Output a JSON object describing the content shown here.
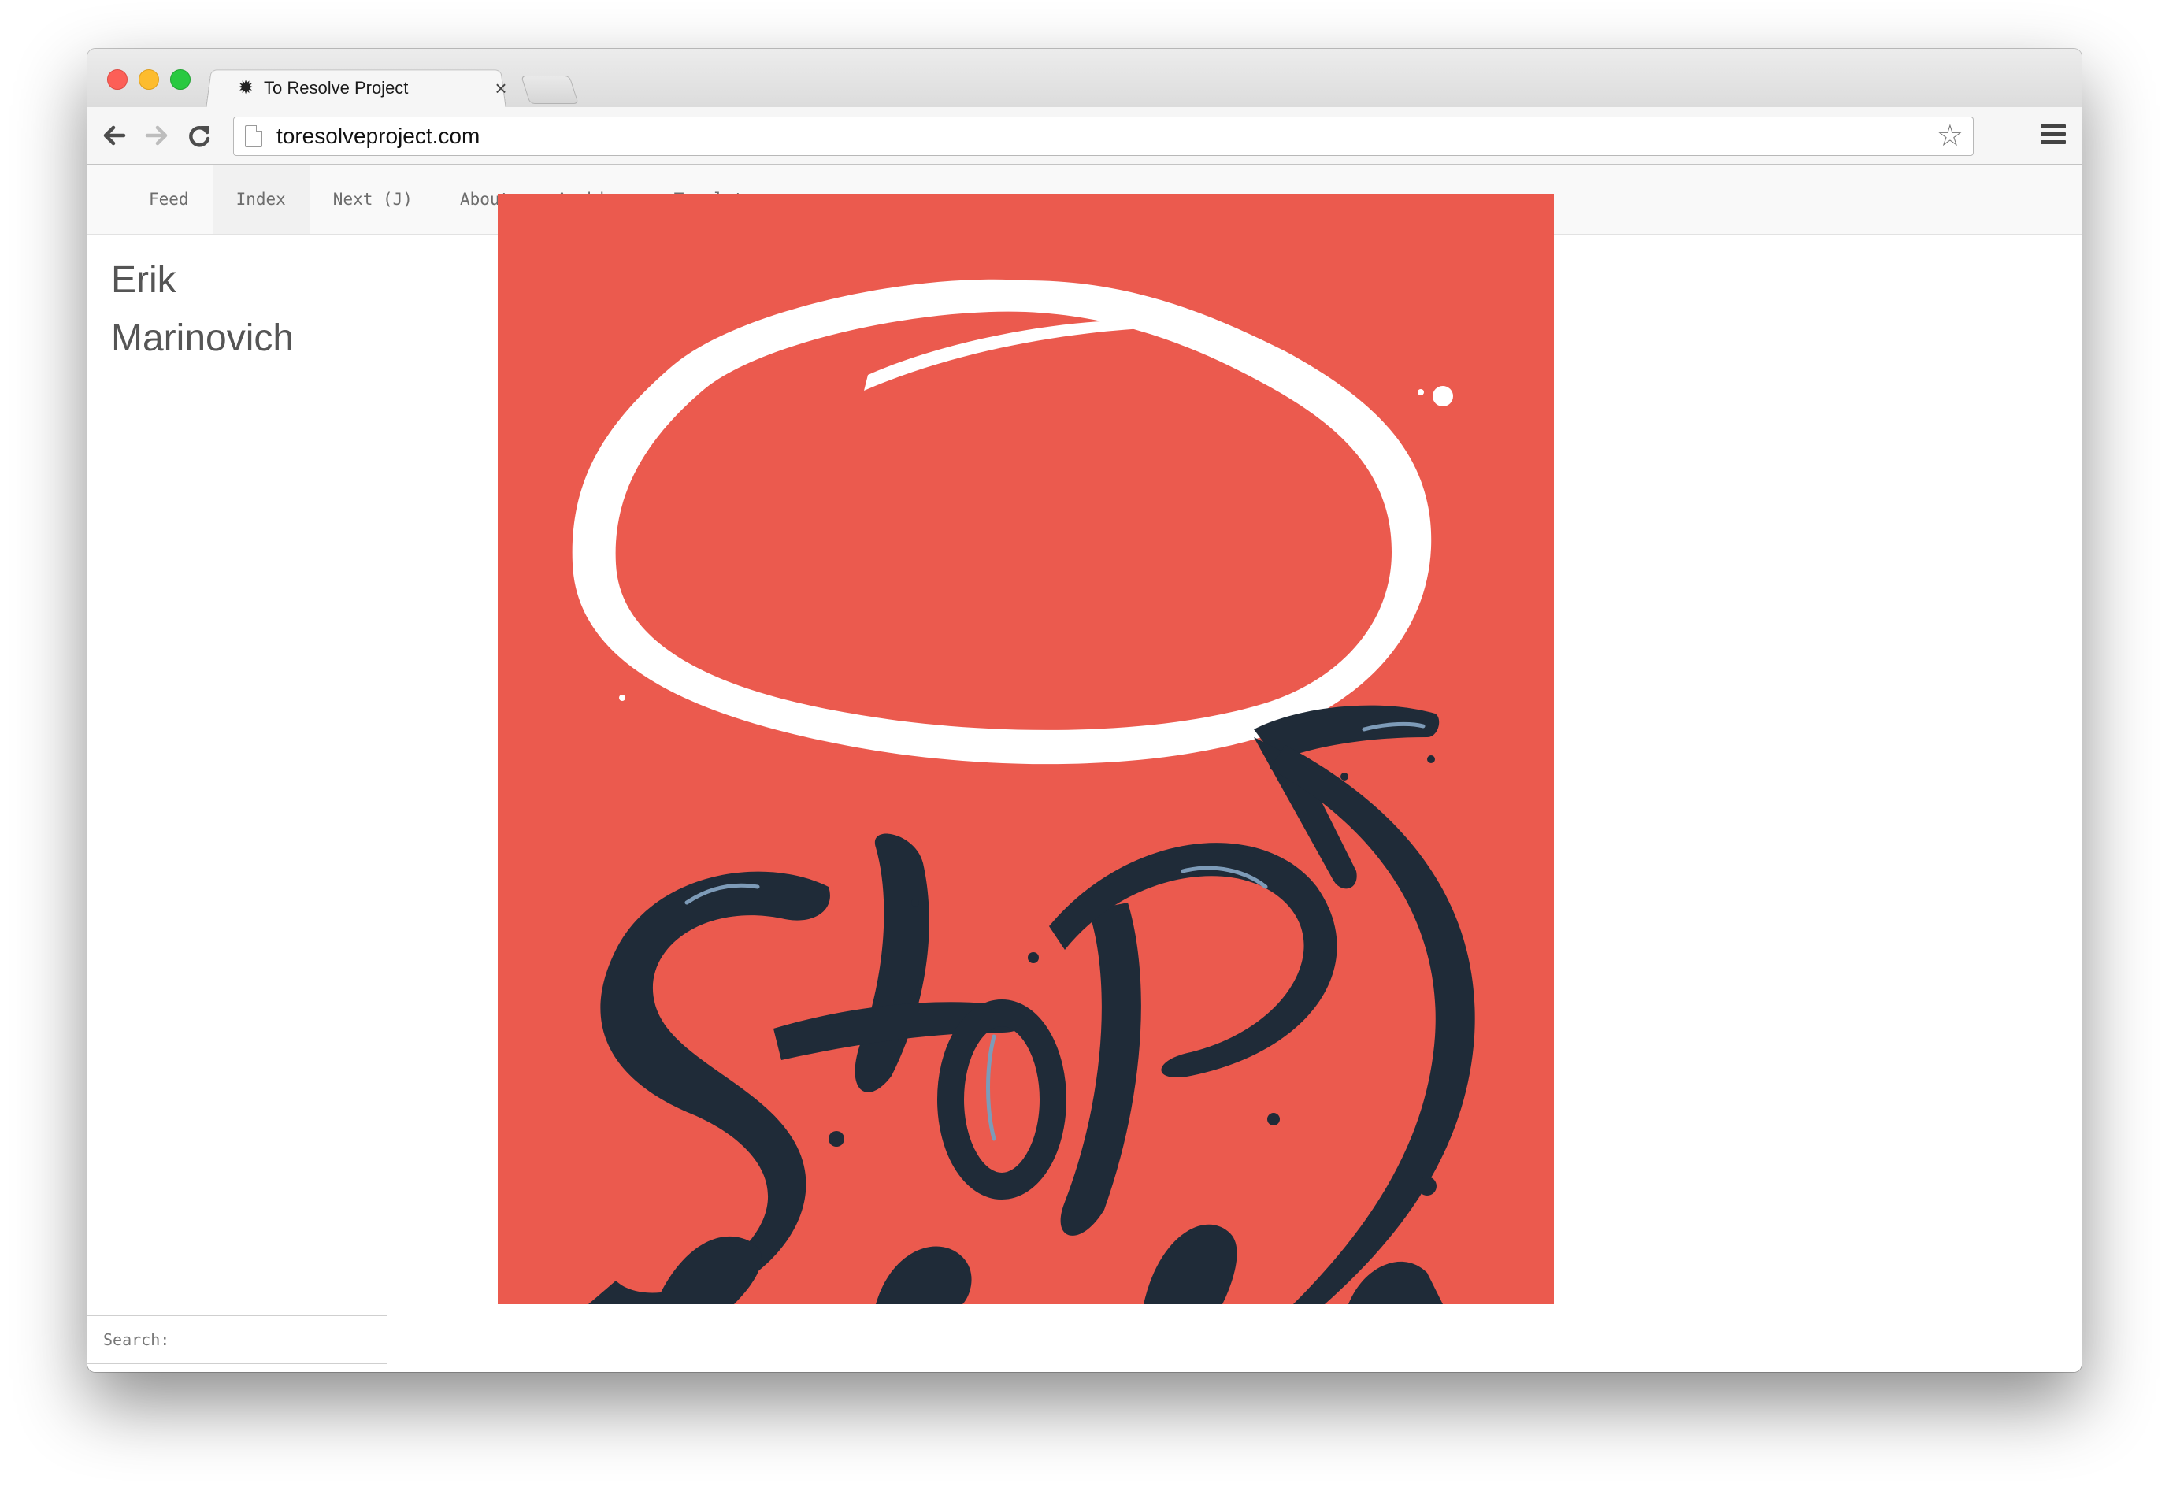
{
  "browser": {
    "tab_title": "To Resolve Project",
    "tab_close": "×",
    "url": "toresolveproject.com",
    "favicon": "sunburst-icon",
    "back_icon": "arrow-left-icon",
    "forward_icon": "arrow-right-icon",
    "reload_icon": "reload-icon",
    "star_icon": "star-icon",
    "menu_icon": "hamburger-menu-icon"
  },
  "site_nav": {
    "items": [
      {
        "label": "Feed"
      },
      {
        "label": "Index"
      },
      {
        "label": "Next (J)"
      },
      {
        "label": "About"
      },
      {
        "label": "Archive"
      },
      {
        "label": "Templates"
      }
    ]
  },
  "sidebar": {
    "author_first": "Erik",
    "author_last": "Marinovich",
    "search_label": "Search:",
    "search_value": ""
  },
  "colors": {
    "artwork_background": "#eb5a4e",
    "lettering": "#1f2b38",
    "bubble": "#ffffff"
  }
}
